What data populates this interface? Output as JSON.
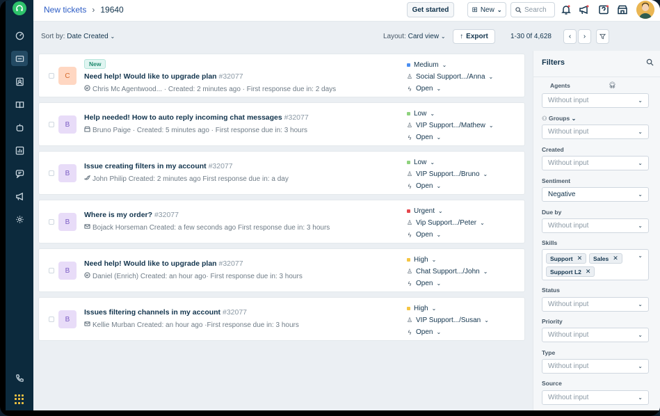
{
  "topbar": {
    "breadcrumb_link": "New tickets",
    "breadcrumb_sep": "›",
    "breadcrumb_current": "19640",
    "get_started": "Get started",
    "new_button": "New",
    "search_placeholder": "Search"
  },
  "toolbar": {
    "sort_prefix": "Sort by:",
    "sort_value": "Date Created",
    "layout_prefix": "Layout:",
    "layout_value": "Card view",
    "export_label": "Export",
    "pagination": "1-30 0f 4,628"
  },
  "tickets": [
    {
      "avatar_letter": "C",
      "avatar_bg": "#ffd7c2",
      "avatar_fg": "#d66a2e",
      "badge": "New",
      "subject": "Need help! Would like to upgrade plan",
      "number": "#32077",
      "meta_icon": "chat-icon",
      "meta": "Chris Mc Agentwood... · Created: 2 minutes ago · First response due in: 2 days",
      "priority": "Medium",
      "priority_color": "#4b8ef1",
      "group": "Social Support.../Anna",
      "status": "Open"
    },
    {
      "avatar_letter": "B",
      "avatar_bg": "#e8dcf8",
      "avatar_fg": "#7b5cc4",
      "badge": "",
      "subject": "Help needed! How to auto reply incoming chat messages",
      "number": "#32077",
      "meta_icon": "store-icon",
      "meta": "Bruno Paige · Created: 5 minutes ago · First response due in: 3 hours",
      "priority": "Low",
      "priority_color": "#8fd27e",
      "group": "VIP Support.../Mathew",
      "status": "Open"
    },
    {
      "avatar_letter": "B",
      "avatar_bg": "#e8dcf8",
      "avatar_fg": "#7b5cc4",
      "badge": "",
      "subject": "Issue creating filters in my account",
      "number": "#32077",
      "meta_icon": "bird-icon",
      "meta": "John Philip   Created: 2 minutes ago   First response due in: a day",
      "priority": "Low",
      "priority_color": "#8fd27e",
      "group": "VIP Support.../Bruno",
      "status": "Open"
    },
    {
      "avatar_letter": "B",
      "avatar_bg": "#e8dcf8",
      "avatar_fg": "#7b5cc4",
      "badge": "",
      "subject": "Where is my order?",
      "number": "#32077",
      "meta_icon": "mail-icon",
      "meta": "Bojack Horseman   Created: a few seconds ago   First response due in: 3 hours",
      "priority": "Urgent",
      "priority_color": "#e5484d",
      "group": "Vip Support.../Peter",
      "status": "Open"
    },
    {
      "avatar_letter": "B",
      "avatar_bg": "#e8dcf8",
      "avatar_fg": "#7b5cc4",
      "badge": "",
      "subject": "Need help! Would like to upgrade plan",
      "number": "#32077",
      "meta_icon": "chat-icon",
      "meta": "Daniel (Enrich)   Created: an hour ago· First response due in: 3 hours",
      "priority": "High",
      "priority_color": "#f5c542",
      "group": "Chat Support.../John",
      "status": "Open"
    },
    {
      "avatar_letter": "B",
      "avatar_bg": "#e8dcf8",
      "avatar_fg": "#7b5cc4",
      "badge": "",
      "subject": "Issues filtering channels in my account",
      "number": "#32077",
      "meta_icon": "mail-icon",
      "meta": "Kellie Murban   Created: an hour ago  ·First response due in: 3 hours",
      "priority": "High",
      "priority_color": "#f5c542",
      "group": "VIP Support.../Susan",
      "status": "Open"
    }
  ],
  "filters": {
    "title": "Filters",
    "agents_label": "Agents",
    "groups_label": "Groups",
    "created_label": "Created",
    "sentiment_label": "Sentiment",
    "due_label": "Due by",
    "skills_label": "Skills",
    "status_label": "Status",
    "priority_label": "Priority",
    "type_label": "Type",
    "source_label": "Source",
    "placeholder": "Without input",
    "sentiment_value": "Negative",
    "skills": [
      "Support",
      "Sales",
      "Support L2"
    ]
  }
}
